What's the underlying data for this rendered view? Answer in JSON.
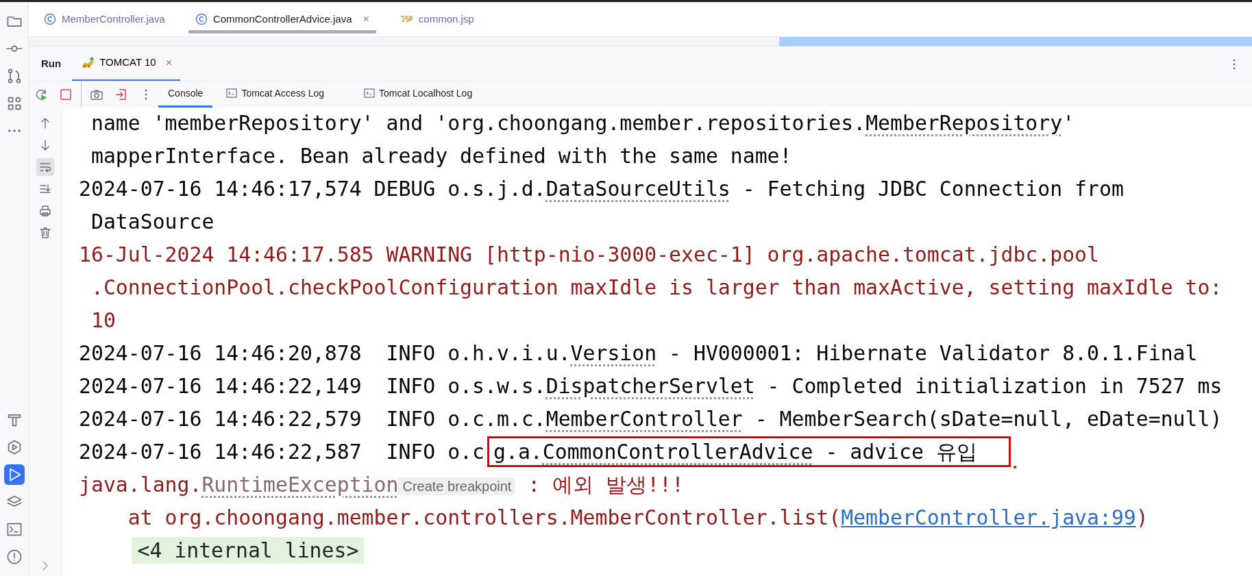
{
  "tool_stripe": {
    "top": [
      {
        "selected": false
      },
      {
        "selected": false
      },
      {
        "selected": false
      },
      {
        "selected": false
      },
      {
        "selected": false
      }
    ],
    "bottom": [
      {
        "selected": false
      },
      {
        "selected": false
      },
      {
        "selected": true
      },
      {
        "selected": false
      },
      {
        "selected": false
      },
      {
        "selected": false
      }
    ]
  },
  "editor_tabs": [
    {
      "label": "MemberController.java",
      "kind": "java",
      "selected": false
    },
    {
      "label": "CommonControllerAdvice.java",
      "kind": "java",
      "selected": true,
      "close": "×"
    },
    {
      "label": "common.jsp",
      "kind": "jsp",
      "selected": false
    }
  ],
  "run_panel": {
    "title": "Run",
    "tabs": [
      {
        "label": "TOMCAT 10",
        "selected": true,
        "close": "×"
      }
    ]
  },
  "console_tabs": [
    {
      "label": "Console",
      "kind": "plain",
      "selected": true
    },
    {
      "label": "Tomcat Access Log",
      "kind": "log",
      "selected": false
    },
    {
      "label": "Tomcat Localhost Log",
      "kind": "log",
      "selected": false
    }
  ],
  "soft_wrap": {
    "on": true
  },
  "console_lines": [
    {
      "kind": "plain",
      "segments": [
        {
          "kind": "text",
          "text": " name 'memberRepository' and 'org.choongang.member.repositories."
        },
        {
          "kind": "ref",
          "text": "MemberRepository"
        },
        {
          "kind": "text",
          "text": "'"
        }
      ]
    },
    {
      "kind": "plain",
      "segments": [
        {
          "kind": "text",
          "text": " mapperInterface. Bean already defined with the same name!"
        }
      ]
    },
    {
      "kind": "plain",
      "segments": [
        {
          "kind": "text",
          "text": "2024-07-16 14:46:17,574 DEBUG o.s.j.d."
        },
        {
          "kind": "ref",
          "text": "DataSourceUtils"
        },
        {
          "kind": "text",
          "text": " - Fetching JDBC Connection from"
        }
      ]
    },
    {
      "kind": "plain",
      "segments": [
        {
          "kind": "text",
          "text": " DataSource"
        }
      ]
    },
    {
      "kind": "warning",
      "segments": [
        {
          "kind": "text",
          "text": "16-Jul-2024 14:46:17.585 WARNING [http-nio-3000-exec-1] org.apache.tomcat.jdbc.pool"
        }
      ]
    },
    {
      "kind": "warning",
      "segments": [
        {
          "kind": "text",
          "text": " .ConnectionPool.checkPoolConfiguration maxIdle is larger than maxActive, setting maxIdle to:"
        }
      ]
    },
    {
      "kind": "warning",
      "segments": [
        {
          "kind": "text",
          "text": " 10"
        }
      ]
    },
    {
      "kind": "plain",
      "segments": [
        {
          "kind": "text",
          "text": "2024-07-16 14:46:20,878  INFO o.h.v.i.u."
        },
        {
          "kind": "ref",
          "text": "Version"
        },
        {
          "kind": "text",
          "text": " - HV000001: Hibernate Validator 8.0.1.Final"
        }
      ]
    },
    {
      "kind": "plain",
      "segments": [
        {
          "kind": "text",
          "text": "2024-07-16 14:46:22,149  INFO o.s.w.s."
        },
        {
          "kind": "ref",
          "text": "DispatcherServlet"
        },
        {
          "kind": "text",
          "text": " - Completed initialization in 7527 ms"
        }
      ]
    },
    {
      "kind": "plain",
      "segments": [
        {
          "kind": "text",
          "text": "2024-07-16 14:46:22,579  INFO o.c.m.c."
        },
        {
          "kind": "ref",
          "text": "MemberController"
        },
        {
          "kind": "text",
          "text": " - MemberSearch(sDate=null, eDate=null)"
        }
      ]
    },
    {
      "kind": "plain",
      "segments": [
        {
          "kind": "text",
          "text": "2024-07-16 14:46:22,587  INFO o.c"
        },
        {
          "kind": "box",
          "segments": [
            {
              "kind": "text",
              "text": "g.a."
            },
            {
              "kind": "ref",
              "text": "CommonControllerAdvice"
            },
            {
              "kind": "text",
              "text": " - advice 유입"
            }
          ]
        }
      ]
    },
    {
      "kind": "error",
      "segments": [
        {
          "kind": "text",
          "text": "java.lang."
        },
        {
          "kind": "ref",
          "text": "RuntimeException"
        },
        {
          "kind": "hint",
          "text": "Create breakpoint"
        },
        {
          "kind": "text",
          "text": " : 예외 발생!!!"
        }
      ]
    },
    {
      "kind": "error",
      "segments": [
        {
          "kind": "text",
          "text": "    at org.choongang.member.controllers.MemberController.list("
        },
        {
          "kind": "link",
          "text": "MemberController.java:99"
        },
        {
          "kind": "text",
          "text": ")"
        }
      ]
    },
    {
      "kind": "folded",
      "segments": [
        {
          "kind": "folded",
          "text": "<4 internal lines>"
        }
      ]
    }
  ]
}
